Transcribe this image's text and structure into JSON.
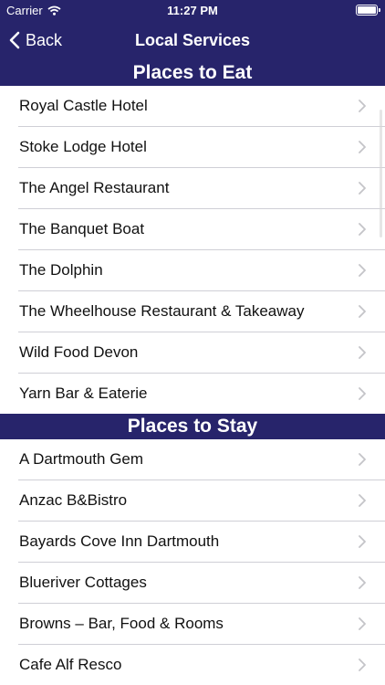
{
  "status": {
    "carrier": "Carrier",
    "time": "11:27 PM"
  },
  "nav": {
    "back_label": "Back",
    "title": "Local Services"
  },
  "sections": [
    {
      "title": "Places to Eat",
      "items": [
        "Royal Castle Hotel",
        "Stoke Lodge Hotel",
        "The Angel Restaurant",
        "The Banquet Boat",
        "The Dolphin",
        "The Wheelhouse Restaurant & Takeaway",
        "Wild Food Devon",
        "Yarn Bar & Eaterie"
      ]
    },
    {
      "title": "Places to Stay",
      "items": [
        "A Dartmouth Gem",
        "Anzac B&Bistro",
        "Bayards Cove Inn Dartmouth",
        "Blueriver Cottages",
        "Browns – Bar, Food & Rooms",
        "Cafe Alf Resco"
      ]
    }
  ],
  "colors": {
    "nav_background": "#27246b",
    "separator": "#cfcfd6",
    "chevron": "#c4c4c8"
  }
}
